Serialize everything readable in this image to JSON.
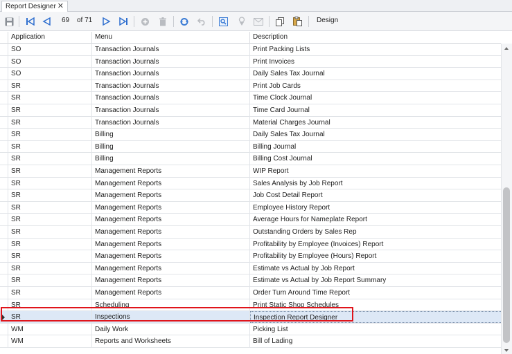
{
  "tab": {
    "title": "Report Designer",
    "close_glyph": "✕"
  },
  "toolbar": {
    "record_current": "69",
    "record_of": "of 71",
    "design_label": "Design",
    "icons": [
      "save-icon",
      "first-record-icon",
      "prev-record-icon",
      "next-record-icon",
      "last-record-icon",
      "add-icon",
      "delete-icon",
      "refresh-icon",
      "undo-icon",
      "preview-icon",
      "filter-icon",
      "email-icon",
      "copy-icon",
      "paste-icon"
    ]
  },
  "grid": {
    "columns": [
      "Application",
      "Menu",
      "Description"
    ],
    "selected_index": 22,
    "rows": [
      [
        "SO",
        "Transaction Journals",
        "Print Packing Lists"
      ],
      [
        "SO",
        "Transaction Journals",
        "Print Invoices"
      ],
      [
        "SO",
        "Transaction Journals",
        "Daily Sales Tax Journal"
      ],
      [
        "SR",
        "Transaction Journals",
        "Print Job Cards"
      ],
      [
        "SR",
        "Transaction Journals",
        "Time Clock Journal"
      ],
      [
        "SR",
        "Transaction Journals",
        "Time Card Journal"
      ],
      [
        "SR",
        "Transaction Journals",
        "Material Charges Journal"
      ],
      [
        "SR",
        "Billing",
        "Daily Sales Tax Journal"
      ],
      [
        "SR",
        "Billing",
        "Billing Journal"
      ],
      [
        "SR",
        "Billing",
        "Billing Cost Journal"
      ],
      [
        "SR",
        "Management Reports",
        "WIP Report"
      ],
      [
        "SR",
        "Management Reports",
        "Sales Analysis by Job Report"
      ],
      [
        "SR",
        "Management Reports",
        "Job Cost Detail Report"
      ],
      [
        "SR",
        "Management Reports",
        "Employee History Report"
      ],
      [
        "SR",
        "Management Reports",
        "Average Hours for Nameplate Report"
      ],
      [
        "SR",
        "Management Reports",
        "Outstanding Orders by Sales Rep"
      ],
      [
        "SR",
        "Management Reports",
        "Profitability by Employee (Invoices) Report"
      ],
      [
        "SR",
        "Management Reports",
        "Profitability by Employee (Hours) Report"
      ],
      [
        "SR",
        "Management Reports",
        "Estimate vs Actual by Job Report"
      ],
      [
        "SR",
        "Management Reports",
        "Estimate vs Actual by Job Report Summary"
      ],
      [
        "SR",
        "Management Reports",
        "Order Turn Around Time Report"
      ],
      [
        "SR",
        "Scheduling",
        "Print Static Shop Schedules"
      ],
      [
        "SR",
        "Inspections",
        "Inspection Report Designer"
      ],
      [
        "WM",
        "Daily Work",
        "Picking List"
      ],
      [
        "WM",
        "Reports and Worksheets",
        "Bill of Lading"
      ]
    ]
  },
  "colors": {
    "highlight": "#e0141b",
    "selected_row": "#dde8f6",
    "nav_arrow": "#2f6fcf"
  }
}
